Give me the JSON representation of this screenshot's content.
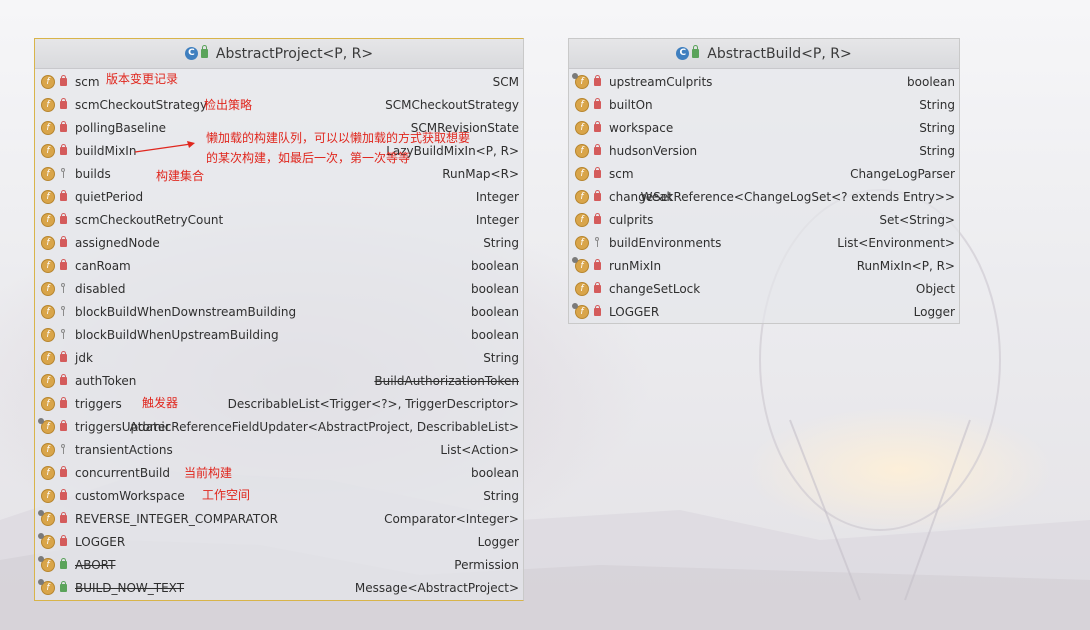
{
  "classes": [
    {
      "title": "AbstractProject<P, R>",
      "fields": [
        {
          "name": "scm",
          "type": "SCM",
          "vis": "private",
          "static": false
        },
        {
          "name": "scmCheckoutStrategy",
          "type": "SCMCheckoutStrategy",
          "vis": "private",
          "static": false
        },
        {
          "name": "pollingBaseline",
          "type": "SCMRevisionState",
          "vis": "private",
          "static": false
        },
        {
          "name": "buildMixIn",
          "type": "LazyBuildMixIn<P, R>",
          "vis": "private",
          "static": false
        },
        {
          "name": "builds",
          "type": "RunMap<R>",
          "vis": "package",
          "static": false
        },
        {
          "name": "quietPeriod",
          "type": "Integer",
          "vis": "private",
          "static": false
        },
        {
          "name": "scmCheckoutRetryCount",
          "type": "Integer",
          "vis": "private",
          "static": false
        },
        {
          "name": "assignedNode",
          "type": "String",
          "vis": "private",
          "static": false
        },
        {
          "name": "canRoam",
          "type": "boolean",
          "vis": "private",
          "static": false
        },
        {
          "name": "disabled",
          "type": "boolean",
          "vis": "package",
          "static": false
        },
        {
          "name": "blockBuildWhenDownstreamBuilding",
          "type": "boolean",
          "vis": "package",
          "static": false
        },
        {
          "name": "blockBuildWhenUpstreamBuilding",
          "type": "boolean",
          "vis": "package",
          "static": false
        },
        {
          "name": "jdk",
          "type": "String",
          "vis": "private",
          "static": false
        },
        {
          "name": "authToken",
          "type": "BuildAuthorizationToken",
          "vis": "private",
          "static": false,
          "type_strike": true
        },
        {
          "name": "triggers",
          "type": "DescribableList<Trigger<?>, TriggerDescriptor>",
          "vis": "private",
          "static": false
        },
        {
          "name": "triggersUpdater",
          "type": "AtomicReferenceFieldUpdater<AbstractProject, DescribableList>",
          "vis": "private",
          "static": true
        },
        {
          "name": "transientActions",
          "type": "List<Action>",
          "vis": "package",
          "static": false
        },
        {
          "name": "concurrentBuild",
          "type": "boolean",
          "vis": "private",
          "static": false
        },
        {
          "name": "customWorkspace",
          "type": "String",
          "vis": "private",
          "static": false
        },
        {
          "name": "REVERSE_INTEGER_COMPARATOR",
          "type": "Comparator<Integer>",
          "vis": "private",
          "static": true
        },
        {
          "name": "LOGGER",
          "type": "Logger",
          "vis": "private",
          "static": true
        },
        {
          "name": "ABORT",
          "type": "Permission",
          "vis": "public",
          "static": true,
          "name_strike": true
        },
        {
          "name": "BUILD_NOW_TEXT",
          "type": "Message<AbstractProject>",
          "vis": "public",
          "static": true,
          "name_strike": true
        }
      ]
    },
    {
      "title": "AbstractBuild<P, R>",
      "fields": [
        {
          "name": "upstreamCulprits",
          "type": "boolean",
          "vis": "private",
          "static": true
        },
        {
          "name": "builtOn",
          "type": "String",
          "vis": "private",
          "static": false
        },
        {
          "name": "workspace",
          "type": "String",
          "vis": "private",
          "static": false
        },
        {
          "name": "hudsonVersion",
          "type": "String",
          "vis": "private",
          "static": false
        },
        {
          "name": "scm",
          "type": "ChangeLogParser",
          "vis": "private",
          "static": false
        },
        {
          "name": "changeSet",
          "type": "WeakReference<ChangeLogSet<? extends Entry>>",
          "vis": "private",
          "static": false
        },
        {
          "name": "culprits",
          "type": "Set<String>",
          "vis": "private",
          "static": false
        },
        {
          "name": "buildEnvironments",
          "type": "List<Environment>",
          "vis": "package",
          "static": false
        },
        {
          "name": "runMixIn",
          "type": "RunMixIn<P, R>",
          "vis": "private",
          "static": true
        },
        {
          "name": "changeSetLock",
          "type": "Object",
          "vis": "private",
          "static": false
        },
        {
          "name": "LOGGER",
          "type": "Logger",
          "vis": "private",
          "static": true
        }
      ]
    }
  ],
  "annotations": [
    {
      "text": "版本变更记录"
    },
    {
      "text": "检出策略"
    },
    {
      "text": "懒加载的构建队列，可以以懒加载的方式获取想要"
    },
    {
      "text": "的某次构建，如最后一次，第一次等等"
    },
    {
      "text": "构建集合"
    },
    {
      "text": "触发器"
    },
    {
      "text": "当前构建"
    },
    {
      "text": "工作空间"
    }
  ],
  "colors": {
    "annotation": "#e0271e",
    "field_icon": "#d9a54a",
    "class_icon": "#3f7fbf"
  }
}
